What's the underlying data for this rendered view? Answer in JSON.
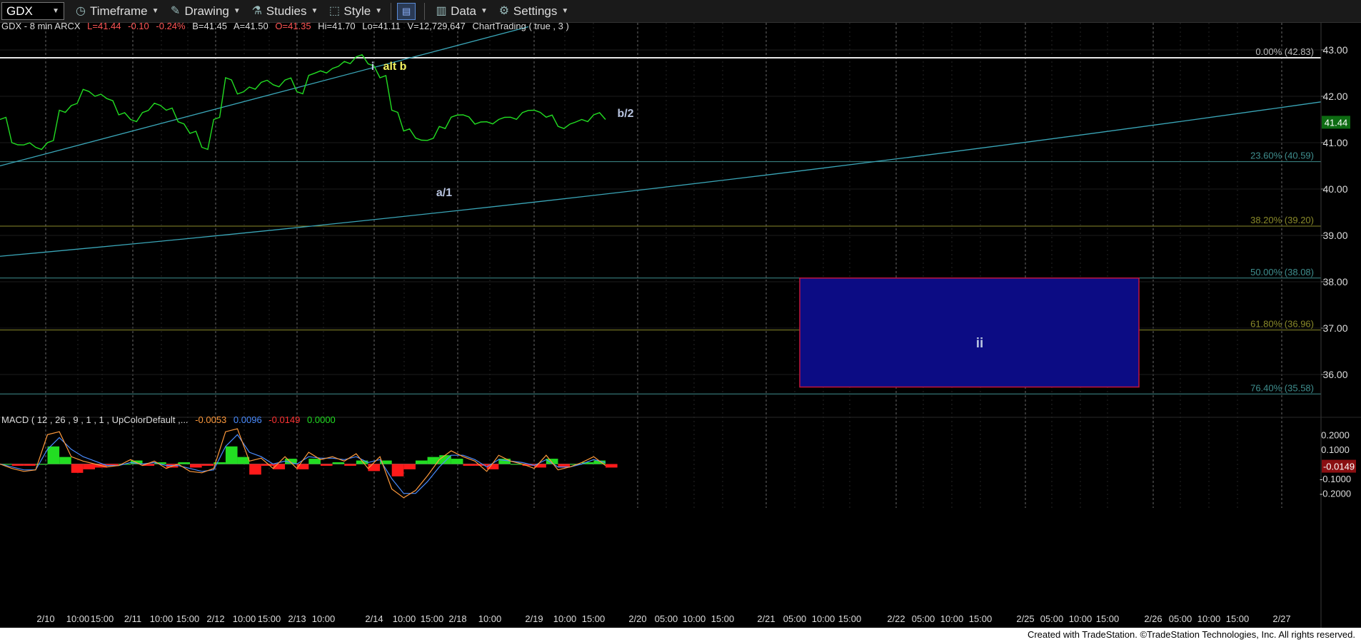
{
  "toolbar": {
    "symbol": "GDX",
    "items": [
      {
        "label": "Timeframe",
        "icon": "clock-icon"
      },
      {
        "label": "Drawing",
        "icon": "pencil-icon"
      },
      {
        "label": "Studies",
        "icon": "flask-icon"
      },
      {
        "label": "Style",
        "icon": "style-icon"
      },
      {
        "label": "Data",
        "icon": "bar-chart-icon"
      },
      {
        "label": "Settings",
        "icon": "gear-icon"
      }
    ]
  },
  "price_header": {
    "prefix": "GDX - 8 min  ARCX",
    "last": "L=41.44",
    "chg": "-0.10",
    "pct": "-0.24%",
    "bid": "B=41.45",
    "ask": "A=41.50",
    "open": "O=41.35",
    "high": "Hi=41.70",
    "low": "Lo=41.11",
    "vol": "V=12,729,647",
    "study": "ChartTrading ( true , 3 )"
  },
  "macd_header": {
    "prefix": "MACD ( 12 , 26 , 9 , 1 , 1 , UpColorDefault ,...",
    "v1": "-0.0053",
    "v2": "0.0096",
    "v3": "-0.0149",
    "v4": "0.0000"
  },
  "colors": {
    "price": "#22dd22",
    "trendline": "#3aa6b8",
    "fib_white": "#e8e8e8",
    "fib_teal": "#3f8f8f",
    "fib_olive": "#8a8a2a",
    "box_fill": "#0c0c84",
    "box_border": "#c0143c",
    "macd_line": "#ff9a3c",
    "signal_line": "#4a8cff",
    "hist_up": "#22dd22",
    "hist_down": "#ff1a1a",
    "annotation_gray": "#b8c4e0",
    "annotation_yellow": "#f2f260"
  },
  "chart_data": {
    "type": "line",
    "ylim": [
      35.2,
      43.4
    ],
    "price_axis_ticks": [
      "43.00",
      "42.00",
      "41.00",
      "40.00",
      "39.00",
      "38.00",
      "37.00",
      "36.00"
    ],
    "last_price": "41.44",
    "fib_levels": [
      {
        "label": "0.00% (42.83)",
        "value": 42.83
      },
      {
        "label": "23.60% (40.59)",
        "value": 40.59
      },
      {
        "label": "38.20% (39.20)",
        "value": 39.2
      },
      {
        "label": "50.00% (38.08)",
        "value": 38.08
      },
      {
        "label": "61.80% (36.96)",
        "value": 36.96
      },
      {
        "label": "76.40% (35.58)",
        "value": 35.58
      }
    ],
    "x_axis_labels": [
      "2/10",
      "10:00",
      "15:00",
      "2/11",
      "10:00",
      "15:00",
      "2/12",
      "10:00",
      "15:00",
      "2/13",
      "10:00",
      "2/14",
      "10:00",
      "15:00",
      "2/18",
      "10:00",
      "2/19",
      "10:00",
      "15:00",
      "2/20",
      "05:00",
      "10:00",
      "15:00",
      "2/21",
      "05:00",
      "10:00",
      "15:00",
      "2/22",
      "05:00",
      "10:00",
      "15:00",
      "2/25",
      "05:00",
      "10:00",
      "15:00",
      "2/26",
      "05:00",
      "10:00",
      "15:00",
      "2/27"
    ],
    "price_series": [
      41.5,
      41.0,
      40.95,
      40.9,
      41.0,
      41.7,
      41.8,
      42.15,
      42.0,
      41.95,
      41.6,
      41.5,
      41.65,
      41.85,
      41.7,
      41.45,
      41.2,
      40.9,
      41.5,
      42.4,
      42.05,
      42.2,
      42.3,
      42.25,
      42.35,
      42.1,
      42.45,
      42.55,
      42.6,
      42.75,
      42.85,
      42.7,
      42.4,
      41.7,
      41.25,
      41.1,
      41.05,
      41.35,
      41.55,
      41.6,
      41.4,
      41.45,
      41.5,
      41.55,
      41.65,
      41.7,
      41.55,
      41.35,
      41.4,
      41.5,
      41.6,
      41.5
    ],
    "annotations": [
      {
        "text": "i",
        "color": "annotation_gray"
      },
      {
        "text": "alt b",
        "color": "annotation_yellow"
      },
      {
        "text": "a/1",
        "color": "annotation_gray"
      },
      {
        "text": "b/2",
        "color": "annotation_gray"
      },
      {
        "text": "ii",
        "color": "annotation_gray"
      }
    ],
    "target_box": {
      "top": 38.08,
      "bottom": 35.58,
      "label": "ii"
    },
    "macd": {
      "ylim": [
        -0.26,
        0.26
      ],
      "ticks": [
        "0.2000",
        "0.1000",
        "-0.1000",
        "-0.2000"
      ],
      "last_value": "-0.0149",
      "macd_series": [
        0.0,
        -0.03,
        -0.05,
        -0.04,
        0.2,
        0.22,
        0.05,
        0.02,
        0.0,
        -0.02,
        -0.01,
        0.03,
        -0.01,
        0.02,
        -0.03,
        0.0,
        -0.05,
        -0.06,
        -0.03,
        0.22,
        0.24,
        0.02,
        0.04,
        -0.03,
        0.05,
        -0.03,
        0.08,
        0.03,
        0.05,
        0.02,
        0.07,
        -0.03,
        0.05,
        -0.17,
        -0.23,
        -0.18,
        -0.08,
        0.03,
        0.09,
        0.05,
        0.02,
        -0.05,
        0.06,
        0.02,
        0.0,
        -0.03,
        0.06,
        -0.04,
        -0.02,
        0.01,
        0.05,
        -0.01
      ],
      "signal_series": [
        0.0,
        -0.02,
        -0.04,
        -0.04,
        0.1,
        0.18,
        0.1,
        0.05,
        0.02,
        -0.01,
        -0.01,
        0.01,
        0.0,
        0.01,
        -0.01,
        -0.01,
        -0.03,
        -0.05,
        -0.04,
        0.12,
        0.2,
        0.08,
        0.05,
        0.0,
        0.02,
        0.0,
        0.05,
        0.04,
        0.04,
        0.03,
        0.05,
        0.01,
        0.03,
        -0.1,
        -0.2,
        -0.2,
        -0.12,
        -0.02,
        0.06,
        0.06,
        0.03,
        -0.02,
        0.03,
        0.02,
        0.01,
        -0.01,
        0.03,
        -0.02,
        -0.02,
        0.0,
        0.03,
        0.01
      ]
    }
  },
  "footer": {
    "text": "Created with TradeStation. ©TradeStation Technologies, Inc. All rights reserved."
  }
}
